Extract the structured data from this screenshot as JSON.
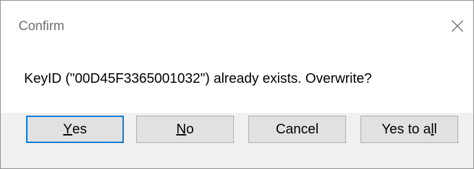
{
  "window": {
    "title": "Confirm",
    "close_icon": "close-icon"
  },
  "message": "KeyID (\"00D45F3365001032\") already exists. Overwrite?",
  "buttons": {
    "yes": {
      "accel": "Y",
      "rest": "es"
    },
    "no": {
      "accel": "N",
      "rest": "o"
    },
    "cancel": {
      "label": "Cancel"
    },
    "yes_to_all": {
      "before": "Yes to a",
      "accel": "l",
      "after": "l"
    }
  },
  "colors": {
    "default_button_border": "#0078d7",
    "button_face": "#e1e1e1",
    "footer_background": "#f0f0f0"
  }
}
